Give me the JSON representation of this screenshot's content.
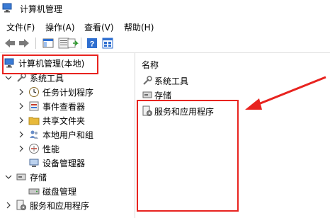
{
  "window": {
    "title": "计算机管理"
  },
  "menu": [
    {
      "label": "文件(F)"
    },
    {
      "label": "操作(A)"
    },
    {
      "label": "查看(V)"
    },
    {
      "label": "帮助(H)"
    }
  ],
  "tree": {
    "root": "计算机管理(本地)",
    "system_tools": "系统工具",
    "task_scheduler": "任务计划程序",
    "event_viewer": "事件查看器",
    "shared_folders": "共享文件夹",
    "local_users": "本地用户和组",
    "performance": "性能",
    "device_manager": "设备管理器",
    "storage": "存储",
    "disk_management": "磁盘管理",
    "services_apps": "服务和应用程序"
  },
  "list": {
    "header": "名称",
    "items": [
      "系统工具",
      "存储",
      "服务和应用程序"
    ]
  },
  "colors": {
    "highlight_red": "#e8231f",
    "accent_blue": "#2f6fd0"
  }
}
